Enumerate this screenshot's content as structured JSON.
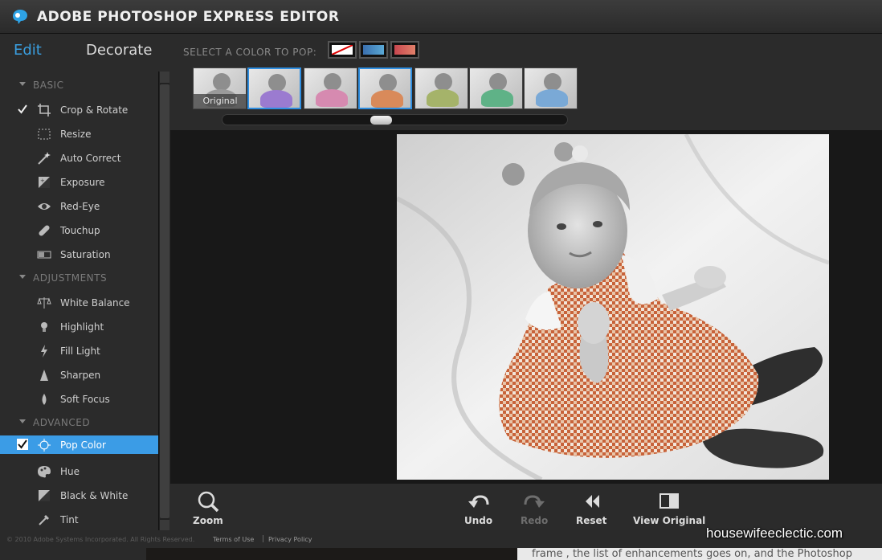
{
  "app": {
    "title": "ADOBE PHOTOSHOP EXPRESS EDITOR",
    "accent": "#3b9ce6"
  },
  "modes": {
    "edit": "Edit",
    "decorate": "Decorate"
  },
  "sections": [
    {
      "label": "BASIC",
      "items": [
        {
          "label": "Crop & Rotate",
          "icon": "crop-icon",
          "checked": true
        },
        {
          "label": "Resize",
          "icon": "resize-icon"
        },
        {
          "label": "Auto Correct",
          "icon": "magic-wand-icon"
        },
        {
          "label": "Exposure",
          "icon": "exposure-icon"
        },
        {
          "label": "Red-Eye",
          "icon": "eye-icon"
        },
        {
          "label": "Touchup",
          "icon": "bandage-icon"
        },
        {
          "label": "Saturation",
          "icon": "saturation-icon"
        }
      ]
    },
    {
      "label": "ADJUSTMENTS",
      "items": [
        {
          "label": "White Balance",
          "icon": "balance-scale-icon"
        },
        {
          "label": "Highlight",
          "icon": "lightbulb-icon"
        },
        {
          "label": "Fill Light",
          "icon": "lightning-icon"
        },
        {
          "label": "Sharpen",
          "icon": "triangle-icon"
        },
        {
          "label": "Soft Focus",
          "icon": "drop-icon"
        }
      ]
    },
    {
      "label": "ADVANCED",
      "items": [
        {
          "label": "Pop Color",
          "icon": "target-icon",
          "checked": true,
          "selected": true
        },
        {
          "label": "Hue",
          "icon": "palette-icon"
        },
        {
          "label": "Black & White",
          "icon": "black-white-icon"
        },
        {
          "label": "Tint",
          "icon": "eyedropper-icon"
        }
      ]
    }
  ],
  "pop": {
    "label": "SELECT A COLOR TO POP:",
    "swatches": [
      "none",
      "blue",
      "red"
    ],
    "thumbnails": [
      {
        "label": "Original",
        "tint": "#9a9a9a"
      },
      {
        "tint": "#9b7bd0",
        "selected": true
      },
      {
        "tint": "#d68ab0"
      },
      {
        "tint": "#d98a5a",
        "selected": true
      },
      {
        "tint": "#a5b36a"
      },
      {
        "tint": "#5fb287"
      },
      {
        "tint": "#7aa9d6"
      }
    ],
    "slider_value": 0.47
  },
  "toolbar": {
    "zoom": "Zoom",
    "undo": "Undo",
    "redo": "Redo",
    "reset": "Reset",
    "view_original": "View Original"
  },
  "footer": {
    "copyright": "© 2010 Adobe Systems Incorporated. All Rights Reserved.",
    "terms": "Terms of Use",
    "separator": "|",
    "privacy": "Privacy Policy",
    "blog_text": "frame , the list of enhancements goes on, and the Photoshop",
    "watermark": "housewifeeclectic.com"
  }
}
